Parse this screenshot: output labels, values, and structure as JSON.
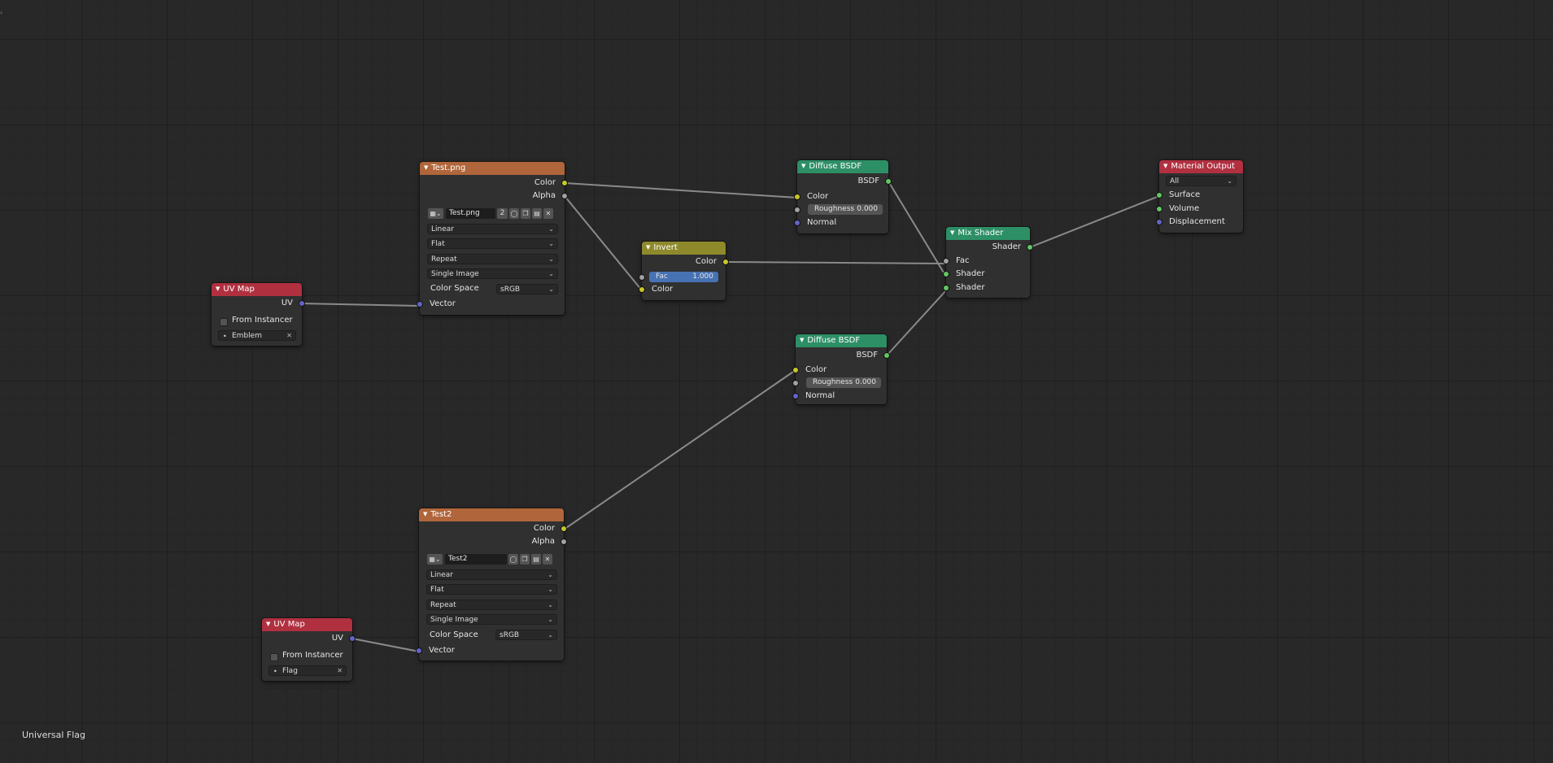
{
  "frame_label": "Universal Flag",
  "colors": {
    "texture_header": "#b0663a",
    "shader_header": "#2d8f66",
    "output_header": "#b03040",
    "uvmap_header": "#b03040",
    "invert_header": "#8e8a2c",
    "socket_color": "#c7c729",
    "socket_float": "#a1a1a1",
    "socket_vector": "#6363c7",
    "socket_shader": "#63c763",
    "link": "#8a8a8a"
  },
  "nodes": {
    "tex1": {
      "title": "Test.png",
      "outputs": [
        "Color",
        "Alpha"
      ],
      "image_name": "Test.png",
      "users": "2",
      "interpolation": "Linear",
      "projection": "Flat",
      "extension": "Repeat",
      "source": "Single Image",
      "color_space_label": "Color Space",
      "color_space": "sRGB",
      "input": "Vector"
    },
    "tex2": {
      "title": "Test2",
      "outputs": [
        "Color",
        "Alpha"
      ],
      "image_name": "Test2",
      "interpolation": "Linear",
      "projection": "Flat",
      "extension": "Repeat",
      "source": "Single Image",
      "color_space_label": "Color Space",
      "color_space": "sRGB",
      "input": "Vector"
    },
    "uv1": {
      "title": "UV Map",
      "output": "UV",
      "from_instancer": "From Instancer",
      "map": "Emblem"
    },
    "uv2": {
      "title": "UV Map",
      "output": "UV",
      "from_instancer": "From Instancer",
      "map": "Flag"
    },
    "invert": {
      "title": "Invert",
      "output": "Color",
      "fac_label": "Fac",
      "fac_value": "1.000",
      "input_color": "Color"
    },
    "diff1": {
      "title": "Diffuse BSDF",
      "output": "BSDF",
      "color": "Color",
      "rough_label": "Roughness",
      "rough_value": "0.000",
      "normal": "Normal"
    },
    "diff2": {
      "title": "Diffuse BSDF",
      "output": "BSDF",
      "color": "Color",
      "rough_label": "Roughness",
      "rough_value": "0.000",
      "normal": "Normal"
    },
    "mix": {
      "title": "Mix Shader",
      "output": "Shader",
      "fac": "Fac",
      "shader1": "Shader",
      "shader2": "Shader"
    },
    "matout": {
      "title": "Material Output",
      "target": "All",
      "surface": "Surface",
      "volume": "Volume",
      "displacement": "Displacement"
    }
  }
}
